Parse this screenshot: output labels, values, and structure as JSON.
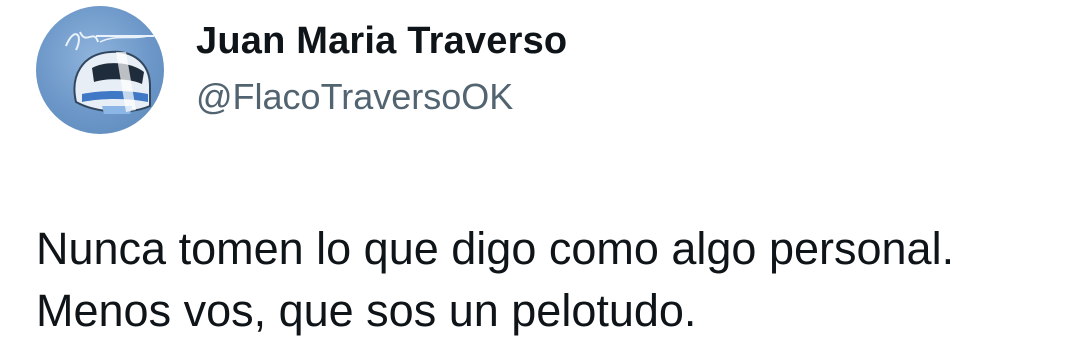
{
  "tweet": {
    "author_name": "Juan Maria Traverso",
    "author_handle": "@FlacoTraversoOK",
    "avatar_icon": "helmet-avatar-icon",
    "text_lines": [
      "Nunca tomen lo que digo como algo personal.",
      "Menos vos, que sos un pelotudo."
    ]
  },
  "colors": {
    "text": "#0f1419",
    "handle": "#536471",
    "avatar_bg": "#6c97c8"
  }
}
